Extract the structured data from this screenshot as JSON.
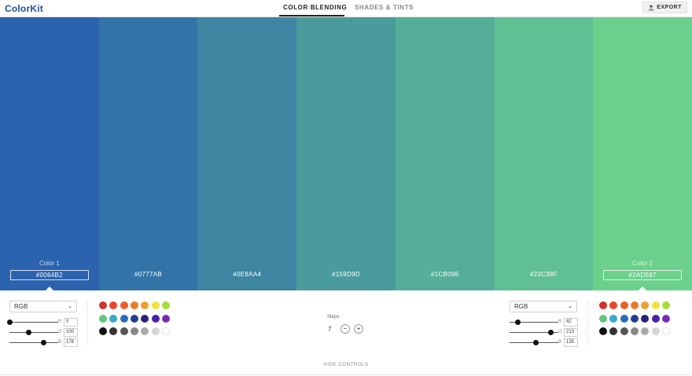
{
  "header": {
    "logo": "ColorKit",
    "tabs": [
      {
        "label": "COLOR BLENDING",
        "active": true
      },
      {
        "label": "SHADES & TINTS",
        "active": false
      }
    ],
    "export_label": "EXPORT"
  },
  "swatches": [
    {
      "hex": "#0064B2",
      "color": "#2B63AF",
      "label": "Color 1"
    },
    {
      "hex": "#0777AB",
      "color": "#3274A8",
      "label": ""
    },
    {
      "hex": "#0E8AA4",
      "color": "#3D85A1",
      "label": ""
    },
    {
      "hex": "#159D9D",
      "color": "#4A9B9B",
      "label": ""
    },
    {
      "hex": "#1CB096",
      "color": "#55AE97",
      "label": ""
    },
    {
      "hex": "#23C38F",
      "color": "#61C093",
      "label": ""
    },
    {
      "hex": "#2AD587",
      "color": "#6BD08C",
      "label": "Color 2"
    }
  ],
  "left_controls": {
    "mode": "RGB",
    "channels": [
      {
        "label": "R",
        "value": "0",
        "level": 0.0
      },
      {
        "label": "G",
        "value": "100",
        "level": 0.39
      },
      {
        "label": "B",
        "value": "178",
        "level": 0.7
      }
    ]
  },
  "right_controls": {
    "mode": "RGB",
    "channels": [
      {
        "label": "R",
        "value": "42",
        "level": 0.16
      },
      {
        "label": "G",
        "value": "213",
        "level": 0.84
      },
      {
        "label": "B",
        "value": "135",
        "level": 0.53
      }
    ]
  },
  "palette": [
    "#D0342C",
    "#E8462C",
    "#EA5E2A",
    "#EC7A2C",
    "#F0A030",
    "#F3E03A",
    "#A6DC3A",
    "#5FC77A",
    "#3BA8C9",
    "#2A6BC0",
    "#1E3E94",
    "#2B237A",
    "#4A22A8",
    "#7A2CB0",
    "#111111",
    "#333333",
    "#555555",
    "#888888",
    "#AAAAAA",
    "#D6D6D6",
    "#FFFFFF"
  ],
  "steps": {
    "label": "Steps",
    "value": "7",
    "minus": "−",
    "plus": "+"
  },
  "hide_controls_label": "HIDE CONTROLS"
}
